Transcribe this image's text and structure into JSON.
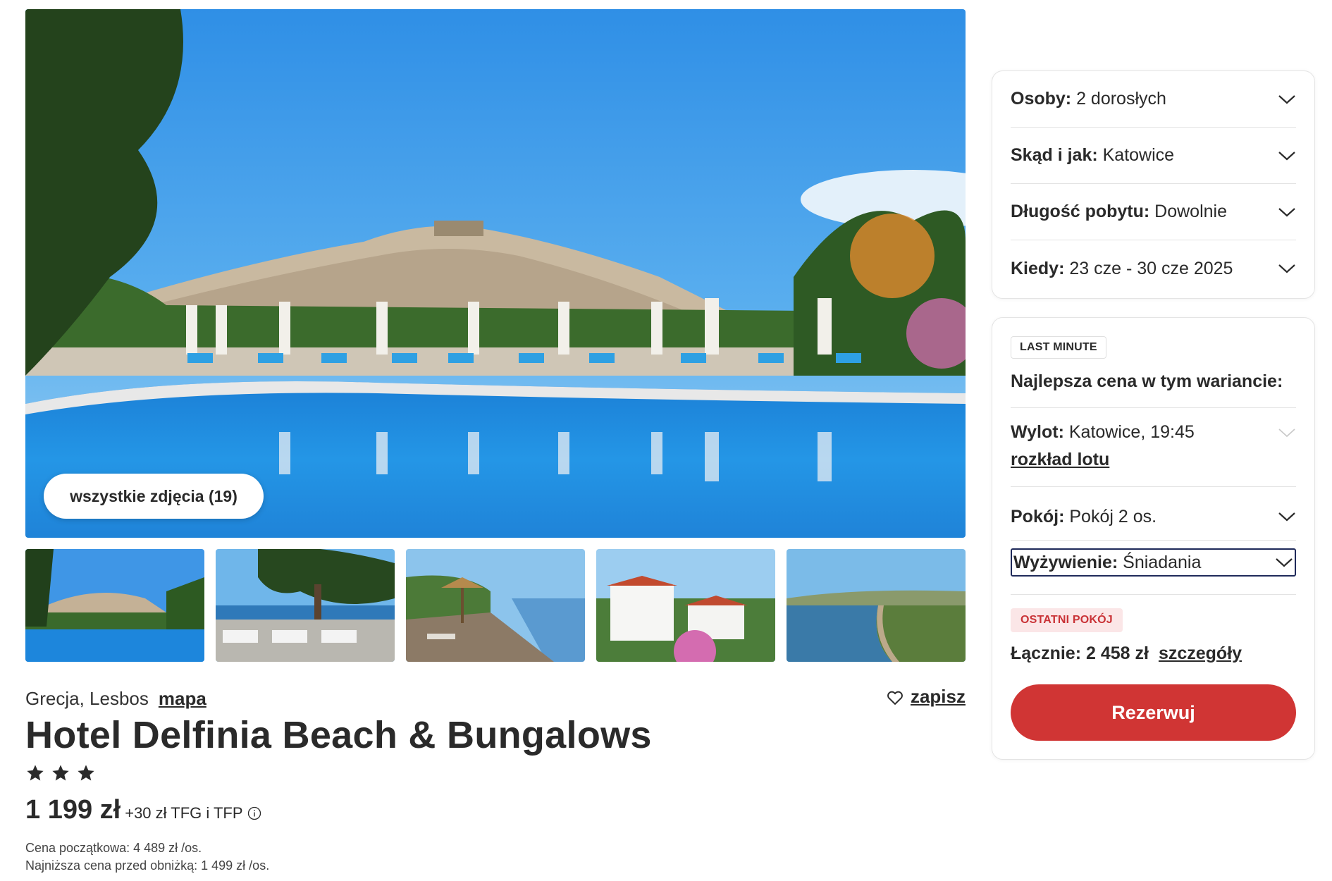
{
  "gallery": {
    "all_photos_label": "wszystkie zdjęcia (19)",
    "thumbnails": [
      {
        "name": "thumbnail-pool"
      },
      {
        "name": "thumbnail-restaurant"
      },
      {
        "name": "thumbnail-beach"
      },
      {
        "name": "thumbnail-bungalows"
      },
      {
        "name": "thumbnail-coast"
      }
    ]
  },
  "hotel": {
    "location": "Grecja, Lesbos",
    "map_label": "mapa",
    "save_label": "zapisz",
    "name": "Hotel Delfinia Beach & Bungalows",
    "stars": 3,
    "price": "1 199 zł",
    "price_extra": "+30 zł TFG i TFP",
    "initial_price": "Cena początkowa: 4 489 zł /os.",
    "lowest_price": "Najniższa cena przed obniżką: 1 499 zł /os."
  },
  "filters": [
    {
      "label": "Osoby:",
      "value": "2 dorosłych"
    },
    {
      "label": "Skąd i jak:",
      "value": "Katowice"
    },
    {
      "label": "Długość pobytu:",
      "value": "Dowolnie"
    },
    {
      "label": "Kiedy:",
      "value": "23 cze - 30 cze 2025"
    }
  ],
  "offer": {
    "badge": "LAST MINUTE",
    "best_price_label": "Najlepsza cena w tym wariancie:",
    "flight_label": "Wylot:",
    "flight_value": "Katowice, 19:45",
    "flight_schedule": "rozkład lotu",
    "room_label": "Pokój:",
    "room_value": "Pokój 2 os.",
    "board_label": "Wyżywienie:",
    "board_value": "Śniadania",
    "last_room_badge": "OSTATNI POKÓJ",
    "total_label": "Łącznie: 2 458 zł",
    "details_label": "szczegóły",
    "book_label": "Rezerwuj"
  },
  "colors": {
    "accent": "#d03534",
    "text": "#2a2a2a",
    "badge_red_bg": "#fbe6e7",
    "badge_red_text": "#c93236",
    "focus_border": "#1f2a5a"
  },
  "icons": [
    "chevron-down-icon",
    "heart-icon",
    "star-icon",
    "info-icon"
  ]
}
